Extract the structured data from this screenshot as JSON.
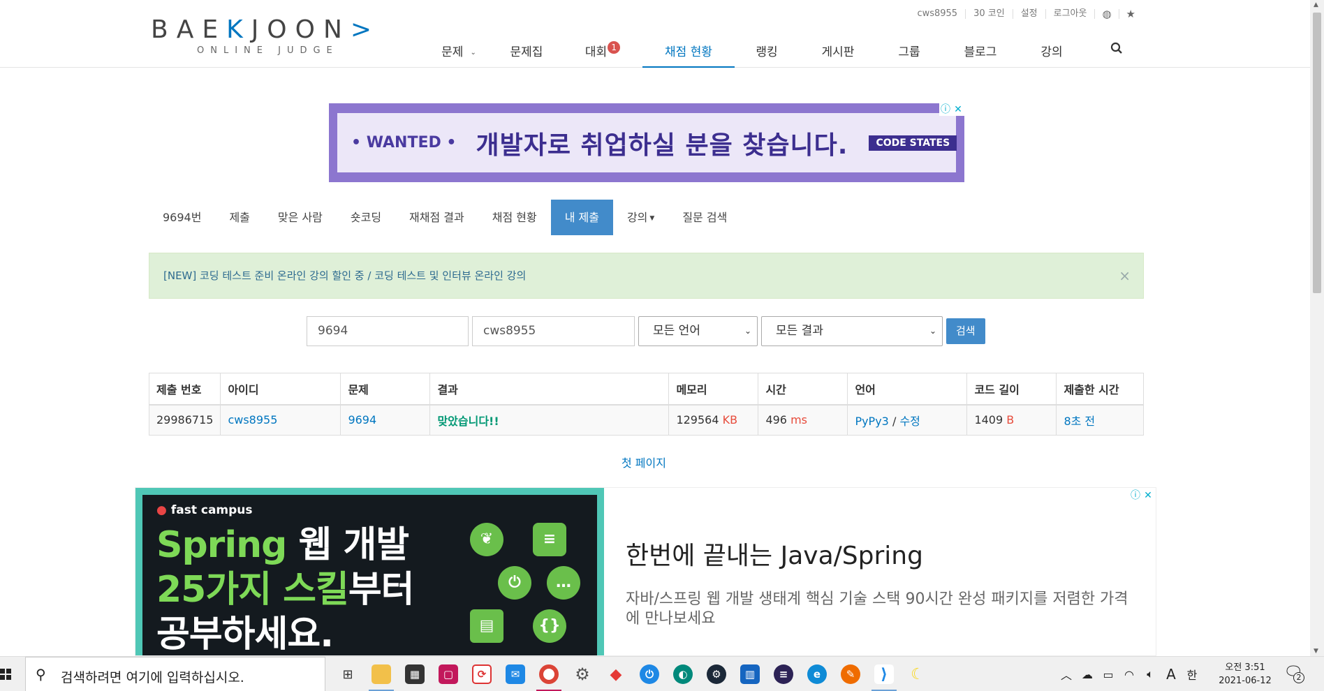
{
  "header": {
    "logo_main_pre": "BAE",
    "logo_main_k": "K",
    "logo_main_post": "JOON",
    "logo_sub": "ONLINE JUDGE",
    "toplinks": [
      "cws8955",
      "30 코인",
      "설정",
      "로그아웃"
    ],
    "nav": [
      {
        "label": "문제",
        "caret": true
      },
      {
        "label": "문제집"
      },
      {
        "label": "대회",
        "badge": "1"
      },
      {
        "label": "채점 현황",
        "active": true
      },
      {
        "label": "랭킹"
      },
      {
        "label": "게시판"
      },
      {
        "label": "그룹"
      },
      {
        "label": "블로그"
      },
      {
        "label": "강의"
      }
    ]
  },
  "ad1": {
    "wanted": "• WANTED •",
    "text": "개발자로 취업하실 분을 찾습니다.",
    "brand": "CODE STATES"
  },
  "subnav": [
    "9694번",
    "제출",
    "맞은 사람",
    "숏코딩",
    "재채점 결과",
    "채점 현황",
    "내 제출",
    "강의",
    "질문 검색"
  ],
  "subnav_active": "내 제출",
  "alert": {
    "text": "[NEW] 코딩 테스트 준비 온라인 강의 할인 중 / 코딩 테스트 및 인터뷰 온라인 강의",
    "close": "×"
  },
  "search": {
    "problem_value": "9694",
    "user_value": "cws8955",
    "language_selected": "모든 언어",
    "result_selected": "모든 결과",
    "button": "검색"
  },
  "table": {
    "headers": [
      "제출 번호",
      "아이디",
      "문제",
      "결과",
      "메모리",
      "시간",
      "언어",
      "코드 길이",
      "제출한 시간"
    ],
    "rows": [
      {
        "id": "29986715",
        "user": "cws8955",
        "problem": "9694",
        "result": "맞았습니다!!",
        "memory": "129564",
        "memory_unit": "KB",
        "time": "496",
        "time_unit": "ms",
        "language": "PyPy3",
        "lang_sep": "/",
        "edit": "수정",
        "code_length": "1409",
        "code_unit": "B",
        "submitted": "8초 전"
      }
    ]
  },
  "pagination": {
    "first": "첫 페이지"
  },
  "ad2": {
    "logo": "fast campus",
    "line1_green": "Spring",
    "line1_white": " 웹 개발",
    "line2_green": "25가지 스킬",
    "line2_white": "부터",
    "line3_white": "공부하세요.",
    "title": "한번에 끝내는 Java/Spring",
    "desc": "자바/스프링 웹 개발 생태계 핵심 기술 스택 90시간 완성 패키지를 저렴한 가격에 만나보세요"
  },
  "taskbar": {
    "search_placeholder": "검색하려면 여기에 입력하십시오.",
    "ime": "한",
    "clock_time": "오전 3:51",
    "clock_date": "2021-06-12",
    "notifications": "2"
  },
  "colors": {
    "accent": "#0076c0",
    "active_tab": "#428bca",
    "accepted": "#009874",
    "unit_red": "#e74c3c",
    "alert_bg": "#dff0d8"
  }
}
